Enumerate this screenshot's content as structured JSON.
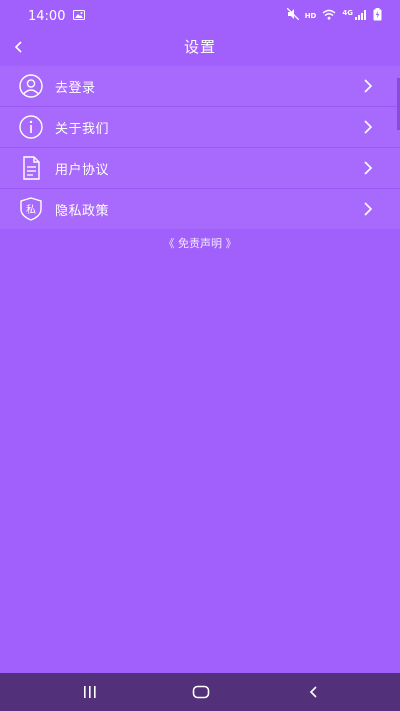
{
  "status_bar": {
    "time": "14:00",
    "hd": "HD",
    "network": "4G"
  },
  "header": {
    "title": "设置"
  },
  "menu": {
    "items": [
      {
        "label": "去登录",
        "icon": "user-icon"
      },
      {
        "label": "关于我们",
        "icon": "info-icon"
      },
      {
        "label": "用户协议",
        "icon": "document-icon"
      },
      {
        "label": "隐私政策",
        "icon": "privacy-shield-icon",
        "icon_text": "私"
      }
    ]
  },
  "footer": {
    "disclaimer": "《 免责声明 》"
  },
  "colors": {
    "background": "#a160fb",
    "list_background": "#a86afc",
    "nav_bar": "#53307a",
    "text": "#ffffff"
  }
}
